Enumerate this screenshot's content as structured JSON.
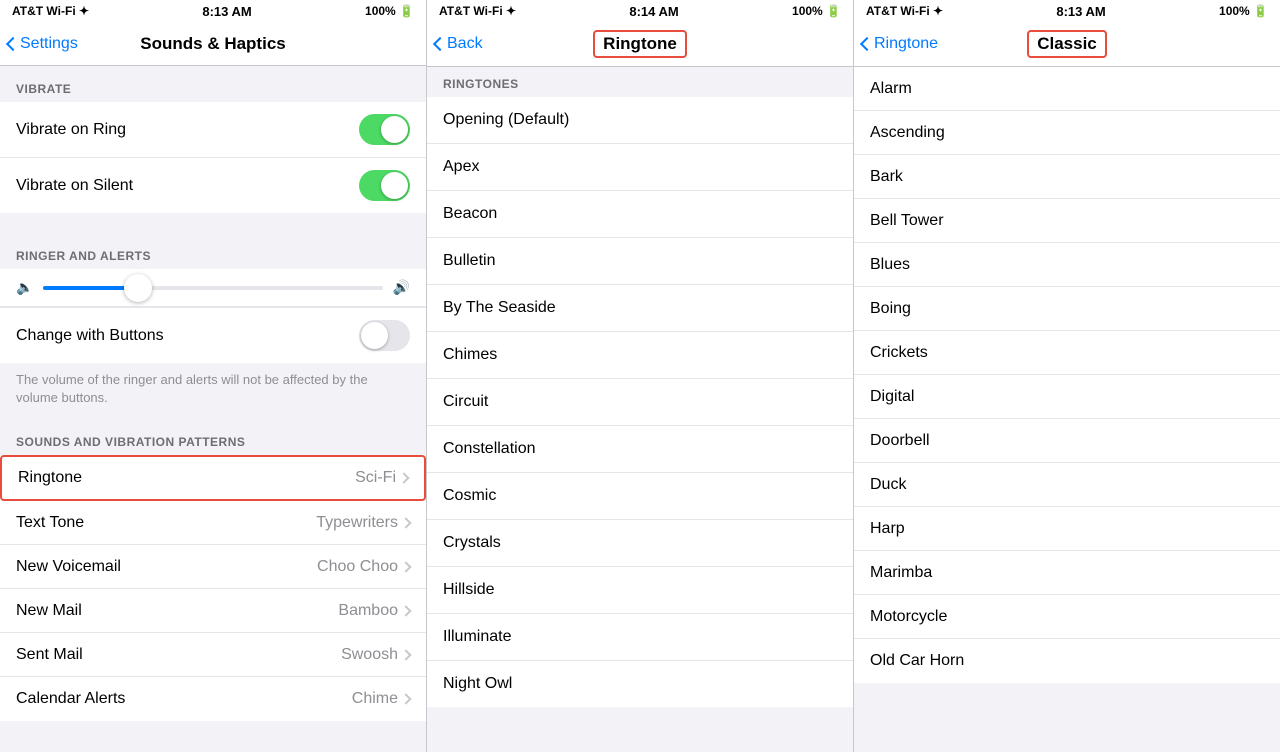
{
  "panel1": {
    "statusBar": {
      "left": "AT&T Wi-Fi ✦",
      "center": "8:13 AM",
      "right": "100% 🔋"
    },
    "navBack": "Settings",
    "navTitle": "Sounds & Haptics",
    "sections": [
      {
        "id": "vibrate",
        "label": "VIBRATE",
        "items": [
          {
            "id": "vibrate-ring",
            "label": "Vibrate on Ring",
            "toggleOn": true
          },
          {
            "id": "vibrate-silent",
            "label": "Vibrate on Silent",
            "toggleOn": true
          }
        ]
      }
    ],
    "ringerSection": "RINGER AND ALERTS",
    "changeWithButtons": "Change with Buttons",
    "changeWithButtonsOn": false,
    "cwbNote": "The volume of the ringer and alerts will not be affected by the volume buttons.",
    "soundsSection": "SOUNDS AND VIBRATION PATTERNS",
    "soundItems": [
      {
        "id": "ringtone",
        "label": "Ringtone",
        "value": "Sci-Fi",
        "boxed": true
      },
      {
        "id": "text-tone",
        "label": "Text Tone",
        "value": "Typewriters"
      },
      {
        "id": "new-voicemail",
        "label": "New Voicemail",
        "value": "Choo Choo"
      },
      {
        "id": "new-mail",
        "label": "New Mail",
        "value": "Bamboo"
      },
      {
        "id": "sent-mail",
        "label": "Sent Mail",
        "value": "Swoosh"
      },
      {
        "id": "calendar-alerts",
        "label": "Calendar Alerts",
        "value": "Chime"
      }
    ]
  },
  "panel2": {
    "statusBar": {
      "left": "AT&T Wi-Fi ✦",
      "center": "8:14 AM",
      "right": "100% 🔋"
    },
    "navBack": "Back",
    "navTitle": "Ringtone",
    "ringtonesSectionLabel": "RINGTONES",
    "ringtones": [
      "Opening (Default)",
      "Apex",
      "Beacon",
      "Bulletin",
      "By The Seaside",
      "Chimes",
      "Circuit",
      "Constellation",
      "Cosmic",
      "Crystals",
      "Hillside",
      "Illuminate",
      "Night Owl"
    ]
  },
  "panel3": {
    "statusBar": {
      "left": "AT&T Wi-Fi ✦",
      "center": "8:13 AM",
      "right": "100% 🔋"
    },
    "navBack": "Ringtone",
    "navTitle": "Classic",
    "classics": [
      "Alarm",
      "Ascending",
      "Bark",
      "Bell Tower",
      "Blues",
      "Boing",
      "Crickets",
      "Digital",
      "Doorbell",
      "Duck",
      "Harp",
      "Marimba",
      "Motorcycle",
      "Old Car Horn"
    ]
  }
}
